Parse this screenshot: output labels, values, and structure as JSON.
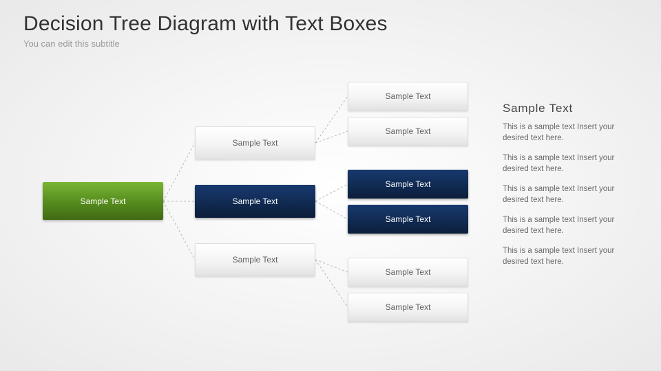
{
  "header": {
    "title": "Decision Tree Diagram with Text Boxes",
    "subtitle": "You can edit this subtitle"
  },
  "tree": {
    "root": {
      "label": "Sample Text"
    },
    "level2": [
      {
        "label": "Sample Text"
      },
      {
        "label": "Sample Text"
      },
      {
        "label": "Sample Text"
      }
    ],
    "level3": [
      {
        "label": "Sample Text"
      },
      {
        "label": "Sample Text"
      },
      {
        "label": "Sample Text"
      },
      {
        "label": "Sample Text"
      },
      {
        "label": "Sample Text"
      },
      {
        "label": "Sample Text"
      }
    ]
  },
  "sidebar": {
    "heading": "Sample Text",
    "paragraphs": [
      "This is a sample text Insert your desired text here.",
      "This is a sample text Insert your desired text here.",
      "This is a sample text Insert your desired text here.",
      "This is a sample text Insert your desired text here.",
      "This is a sample text Insert your desired text here."
    ]
  },
  "colors": {
    "root_green": "#558b1d",
    "selected_blue": "#10294f",
    "light_box": "#f1f1f1"
  }
}
